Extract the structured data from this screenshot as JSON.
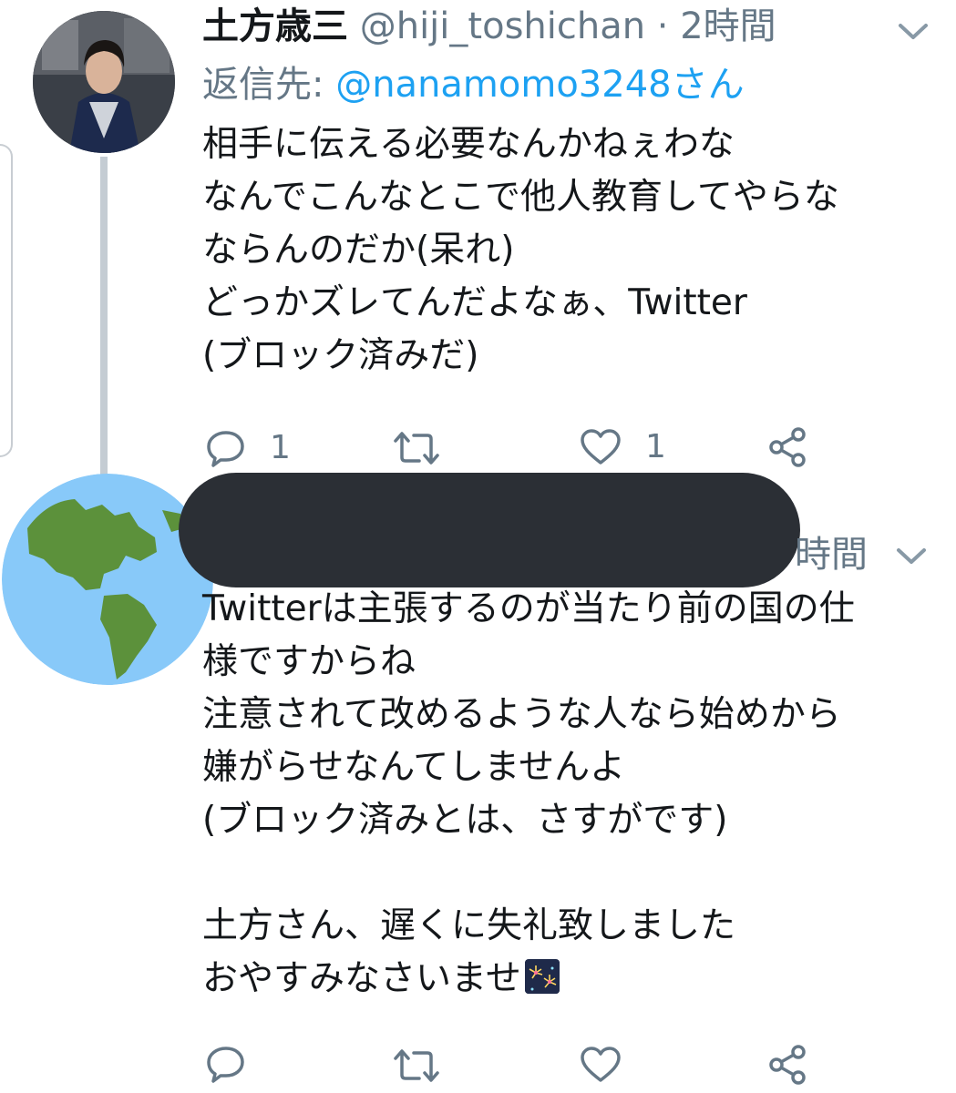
{
  "colors": {
    "text": "#14171a",
    "muted": "#657786",
    "link": "#1da1f2",
    "thread_line": "#c4ccd3",
    "redaction": "#2b2f35"
  },
  "tweet1": {
    "display_name": "土方歳三",
    "handle": "@hiji_toshichan",
    "separator": "·",
    "time": "2時間",
    "reply_prefix": "返信先: ",
    "reply_to": "@nanamomo3248さん",
    "lines": [
      "相手に伝える必要なんかねぇわな",
      "なんでこんなとこで他人教育してやらな",
      "ならんのだか(呆れ)",
      "どっかズレてんだよなぁ、Twitter",
      "(ブロック済みだ)"
    ],
    "actions": {
      "reply_count": "1",
      "like_count": "1"
    }
  },
  "tweet2": {
    "time_partial": "時間",
    "lines": [
      "Twitterは主張するのが当たり前の国の仕",
      "様ですからね",
      "注意されて改めるような人なら始めから",
      "嫌がらせなんてしませんよ",
      "(ブロック済みとは、さすがです)",
      "",
      "土方さん、遅くに失礼致しました",
      "おやすみなさいませ"
    ],
    "emoji": "fireworks"
  },
  "icons": [
    "chevron-down-icon",
    "reply-icon",
    "retweet-icon",
    "like-icon",
    "share-icon",
    "earth-globe-icon",
    "fireworks-emoji-icon"
  ]
}
